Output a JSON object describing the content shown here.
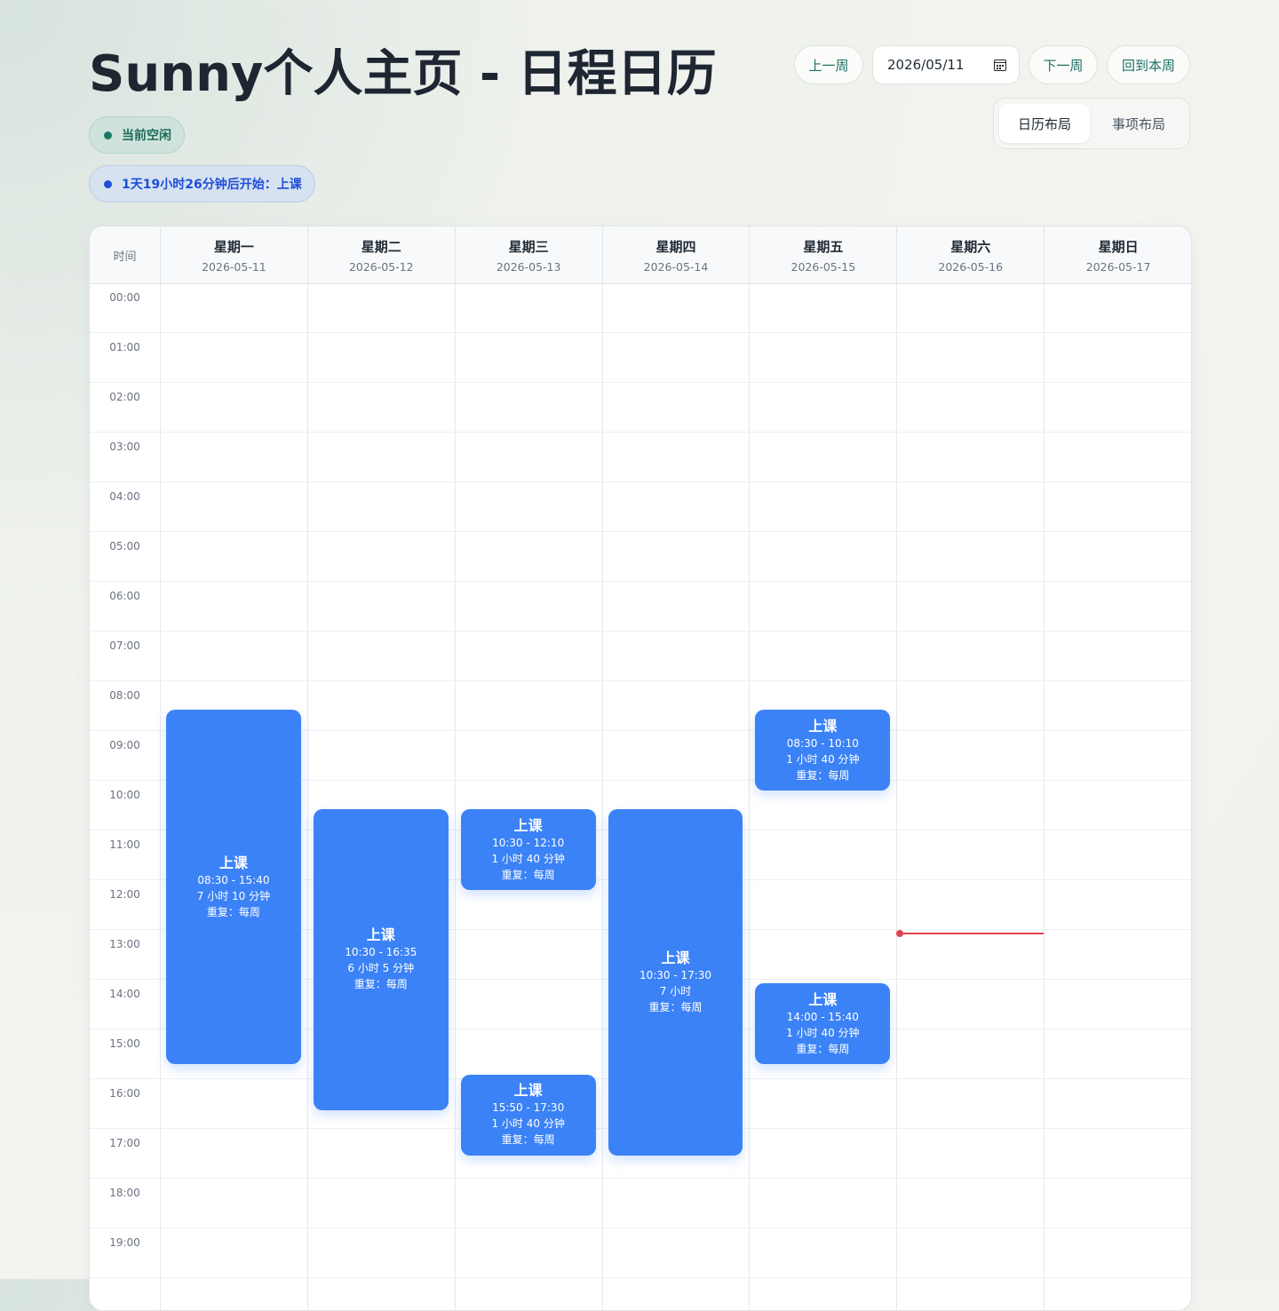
{
  "header": {
    "title": "Sunny个人主页 - 日程日历",
    "status_idle": "当前空闲",
    "next_event": "1天19小时26分钟后开始：上课"
  },
  "nav": {
    "prev_week": "上一周",
    "date_value": "2026/05/11",
    "next_week": "下一周",
    "this_week": "回到本周"
  },
  "layout_switch": {
    "calendar_label": "日历布局",
    "list_label": "事项布局",
    "active": "日历布局"
  },
  "calendar": {
    "time_header": "时间",
    "days": [
      {
        "name": "星期一",
        "date": "2026-05-11"
      },
      {
        "name": "星期二",
        "date": "2026-05-12"
      },
      {
        "name": "星期三",
        "date": "2026-05-13"
      },
      {
        "name": "星期四",
        "date": "2026-05-14"
      },
      {
        "name": "星期五",
        "date": "2026-05-15"
      },
      {
        "name": "星期六",
        "date": "2026-05-16"
      },
      {
        "name": "星期日",
        "date": "2026-05-17"
      }
    ],
    "hours": [
      "00:00",
      "01:00",
      "02:00",
      "03:00",
      "04:00",
      "05:00",
      "06:00",
      "07:00",
      "08:00",
      "09:00",
      "10:00",
      "11:00",
      "12:00",
      "13:00",
      "14:00",
      "15:00",
      "16:00",
      "17:00",
      "18:00",
      "19:00"
    ],
    "events": [
      {
        "day": 0,
        "title": "上课",
        "time": "08:30 - 15:40",
        "duration": "7 小时 10 分钟",
        "repeat": "重复：每周"
      },
      {
        "day": 1,
        "title": "上课",
        "time": "10:30 - 16:35",
        "duration": "6 小时 5 分钟",
        "repeat": "重复：每周"
      },
      {
        "day": 2,
        "title": "上课",
        "time": "10:30 - 12:10",
        "duration": "1 小时 40 分钟",
        "repeat": "重复：每周"
      },
      {
        "day": 2,
        "title": "上课",
        "time": "15:50 - 17:30",
        "duration": "1 小时 40 分钟",
        "repeat": "重复：每周"
      },
      {
        "day": 3,
        "title": "上课",
        "time": "10:30 - 17:30",
        "duration": "7 小时",
        "repeat": "重复：每周"
      },
      {
        "day": 4,
        "title": "上课",
        "time": "08:30 - 10:10",
        "duration": "1 小时 40 分钟",
        "repeat": "重复：每周"
      },
      {
        "day": 4,
        "title": "上课",
        "time": "14:00 - 15:40",
        "duration": "1 小时 40 分钟",
        "repeat": "重复：每周"
      }
    ],
    "now_indicator": {
      "day": 5,
      "time": "13:04"
    },
    "event_color": "#3b82f6",
    "now_color": "#e0434f"
  }
}
